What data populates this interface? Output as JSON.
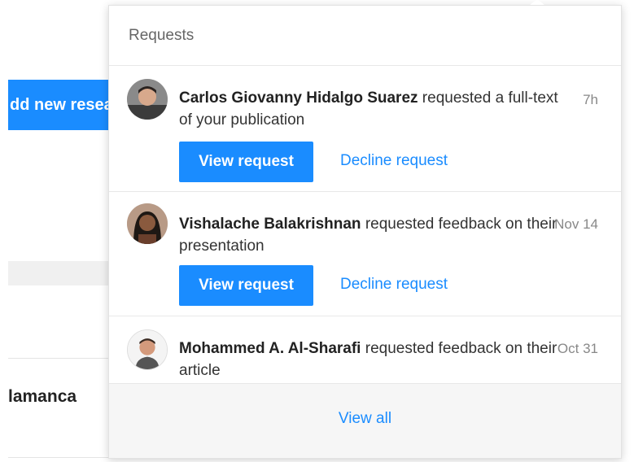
{
  "background": {
    "button_label": "dd new resea",
    "text": "lamanca"
  },
  "popover": {
    "title": "Requests",
    "requests": [
      {
        "name": "Carlos Giovanny Hidalgo Suarez",
        "message": " requested a full-text of your publication",
        "time": "7h",
        "view_label": "View request",
        "decline_label": "Decline request"
      },
      {
        "name": "Vishalache Balakrishnan",
        "message": " requested feedback on their presentation",
        "time": "Nov 14",
        "view_label": "View request",
        "decline_label": "Decline request"
      },
      {
        "name": "Mohammed A. Al-Sharafi",
        "message": " requested feedback on their article",
        "time": "Oct 31"
      }
    ],
    "view_all_label": "View all"
  }
}
